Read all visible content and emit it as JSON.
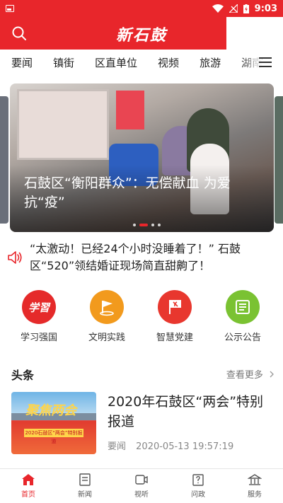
{
  "status_bar": {
    "time": "9:03"
  },
  "header": {
    "logo_text": "新石鼓"
  },
  "tabs": [
    "要闻",
    "镇街",
    "区直单位",
    "视频",
    "旅游",
    "湖南"
  ],
  "banner": {
    "caption": "石鼓区“衡阳群众”：无偿献血 为爱抗“疫”",
    "slide_count": 5,
    "active_slide": 2
  },
  "notice": {
    "text": "“太激动！已经24个小时没睡着了！” 石鼓区“520”领结婚证现场简直甜齁了！"
  },
  "quick_links": [
    {
      "label": "学习强国",
      "icon": "xuexi-icon",
      "color": "#e52a2a"
    },
    {
      "label": "文明实践",
      "icon": "flag-icon",
      "color": "#f29a1d"
    },
    {
      "label": "智慧党建",
      "icon": "party-flag-icon",
      "color": "#e8372e"
    },
    {
      "label": "公示公告",
      "icon": "notice-board-icon",
      "color": "#7ac232"
    }
  ],
  "headlines": {
    "title": "头条",
    "more_label": "查看更多",
    "items": [
      {
        "title": "2020年石鼓区“两会”特别报道",
        "category": "要闻",
        "datetime": "2020-05-13 19:57:19"
      }
    ]
  },
  "bottom_nav": [
    {
      "label": "首页",
      "icon": "home-icon",
      "active": true
    },
    {
      "label": "新闻",
      "icon": "news-icon",
      "active": false
    },
    {
      "label": "视听",
      "icon": "video-icon",
      "active": false
    },
    {
      "label": "问政",
      "icon": "inquiry-icon",
      "active": false
    },
    {
      "label": "服务",
      "icon": "service-icon",
      "active": false
    }
  ],
  "colors": {
    "brand_red": "#e8262b"
  }
}
